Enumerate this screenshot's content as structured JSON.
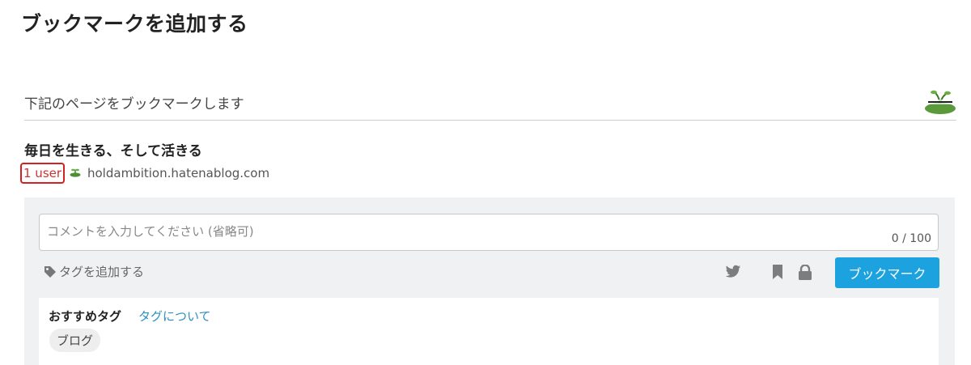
{
  "page_title": "ブックマークを追加する",
  "subheader": "下記のページをブックマークします",
  "site_logo_alt": "site-logo",
  "entry": {
    "title": "毎日を生きる、そして活きる",
    "users": "1 user",
    "domain": "holdambition.hatenablog.com"
  },
  "form": {
    "comment_placeholder": "コメントを入力してください (省略可)",
    "char_count": "0 / 100",
    "add_tag": "タグを追加する",
    "submit_label": "ブックマーク"
  },
  "recommend": {
    "label": "おすすめタグ",
    "about_link": "タグについて",
    "tags": [
      "ブログ"
    ]
  },
  "colors": {
    "accent": "#1da2e0",
    "highlight": "#d42020",
    "link": "#2d8fc4"
  }
}
